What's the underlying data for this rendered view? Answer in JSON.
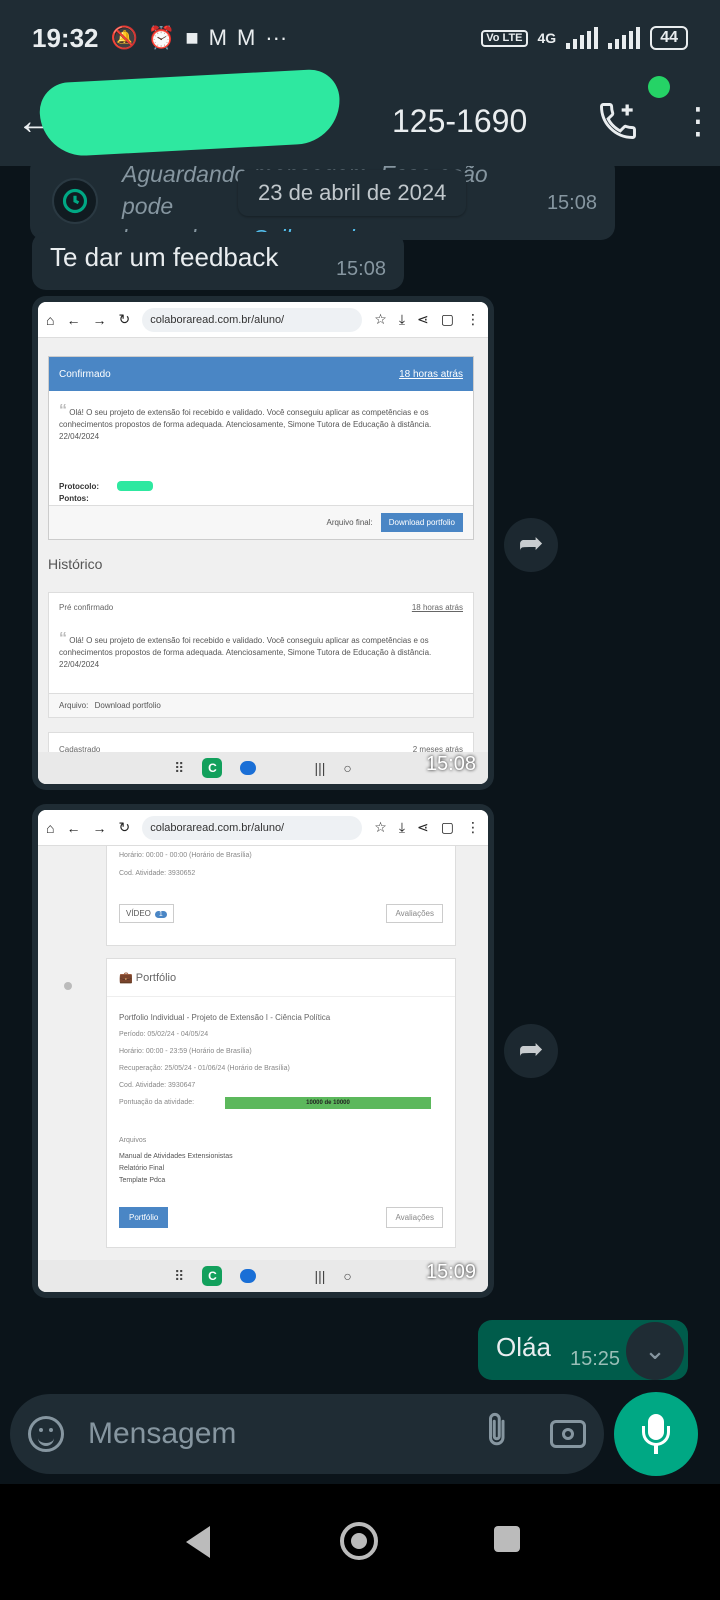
{
  "status_bar": {
    "time": "19:32",
    "notif_icons": [
      "dnd-off-icon",
      "alarm-icon",
      "square-icon",
      "gmail-icon",
      "gmail-icon",
      "more-icon"
    ],
    "volte": "Vo LTE",
    "network": "4G",
    "battery": "44"
  },
  "app_bar": {
    "contact_visible_suffix": "125-1690"
  },
  "chat": {
    "system_message": {
      "text_line1": "Aguardando mensagem. Essa ação pode",
      "text_line2": "levar alguns",
      "link": "Saiba mais",
      "time": "15:08"
    },
    "date_chip": "23 de abril de 2024",
    "messages": [
      {
        "type": "text",
        "direction": "in",
        "text": "Te dar um feedback",
        "time": "15:08"
      },
      {
        "type": "image",
        "direction": "in",
        "time": "15:08",
        "screenshot": {
          "url": "colaboraread.com.br/aluno/",
          "status_header": "Confirmado",
          "status_time": "18 horas atrás",
          "feedback_text": "Olá! O seu projeto de extensão foi recebido e validado. Você conseguiu aplicar as competências e os conhecimentos propostos de forma adequada. Atenciosamente, Simone Tutora de Educação à distância. 22/04/2024",
          "protocolo_label": "Protocolo:",
          "pontos_label": "Pontos:",
          "arquivo_final_label": "Arquivo final:",
          "download_button": "Download portfolio",
          "historico_title": "Histórico",
          "pre_confirmado": "Pré confirmado",
          "pre_confirmado_time": "18 horas atrás",
          "arquivo_label": "Arquivo:",
          "arquivo_link": "Download portfolio",
          "cadastrado": "Cadastrado",
          "cadastrado_time": "2 meses atrás"
        }
      },
      {
        "type": "image",
        "direction": "in",
        "time": "15:09",
        "screenshot": {
          "url": "colaboraread.com.br/aluno/",
          "horario_top": "Horário: 00:00 - 00:00 (Horário de Brasília)",
          "cod_top": "Cod. Atividade: 3930652",
          "video_button": "VÍDEO",
          "video_count": "1",
          "avaliacoes_button": "Avaliações",
          "portfolio_heading": "Portfólio",
          "portfolio_title": "Portfolio Individual - Projeto de Extensão I - Ciência Política",
          "periodo": "Período: 05/02/24 - 04/05/24",
          "horario": "Horário: 00:00 - 23:59 (Horário de Brasília)",
          "recuperacao": "Recuperação: 25/05/24 - 01/06/24 (Horário de Brasília)",
          "cod": "Cod. Atividade: 3930647",
          "pontuacao_label": "Pontuação da atividade:",
          "pontuacao_value": "10000 de 10000",
          "pontuacao_fraction": 1.0,
          "arquivos_label": "Arquivos",
          "files": [
            "Manual de Atividades Extensionistas",
            "Relatório Final",
            "Template Pdca"
          ],
          "portfolio_button": "Portfólio",
          "avaliacoes_button2": "Avaliações"
        }
      },
      {
        "type": "text",
        "direction": "out",
        "text": "Oláa",
        "time": "15:25"
      }
    ]
  },
  "composer": {
    "placeholder": "Mensagem"
  },
  "colors": {
    "background": "#0b141a",
    "header": "#1f2c34",
    "incoming_bubble": "#1f2c34",
    "outgoing_bubble": "#005c4b",
    "accent": "#00a884",
    "link": "#53bdeb"
  }
}
